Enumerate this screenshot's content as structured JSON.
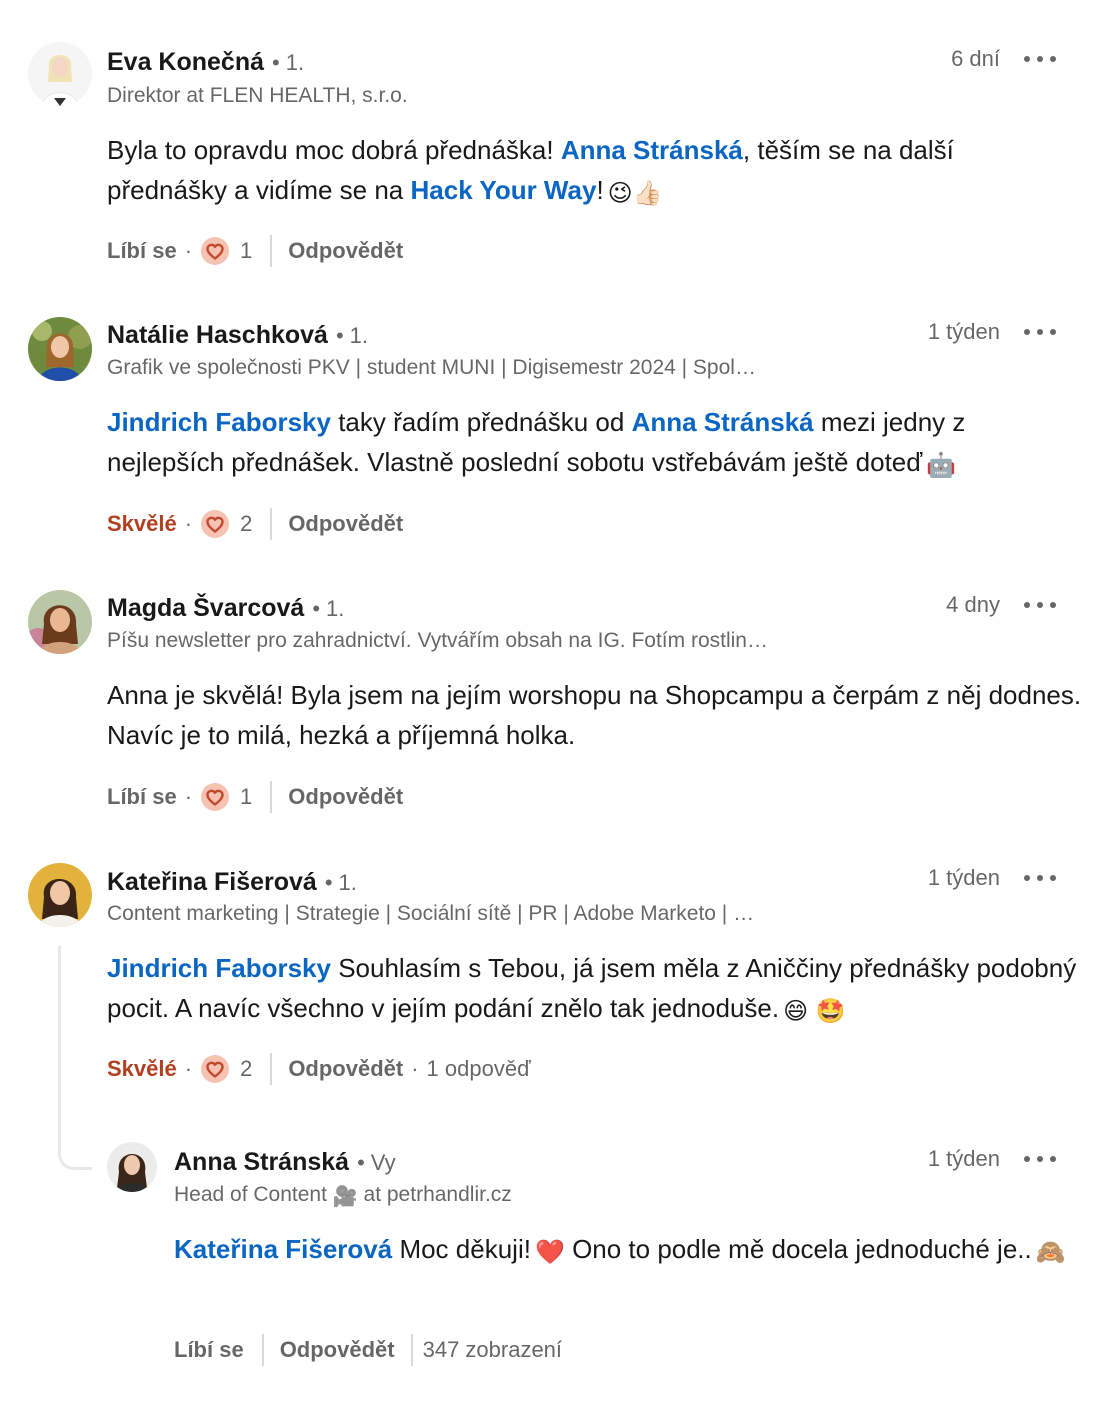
{
  "comments": [
    {
      "author": "Eva Konečná",
      "degree": "1.",
      "headline": "Direktor at FLEN HEALTH, s.r.o.",
      "time": "6 dní",
      "text": {
        "p1": "Byla to opravdu moc dobrá přednáška! ",
        "mention1": "Anna Stránská",
        "p2": ", těším se na další přednášky a vidíme se na ",
        "mention2": "Hack Your Way",
        "p3": "!",
        "emoji": "😉👍🏻"
      },
      "like_label": "Líbí se",
      "reaction_count": "1",
      "reply_label": "Odpovědět"
    },
    {
      "author": "Natálie Haschková",
      "degree": "1.",
      "headline": "Grafik ve společnosti PKV | student MUNI | Digisemestr 2024 | Spol…",
      "time": "1 týden",
      "text": {
        "mention1": "Jindrich Faborsky",
        "p1": " taky řadím přednášku od ",
        "mention2": "Anna Stránská",
        "p2": " mezi jedny z nejlepších přednášek. Vlastně poslední sobotu vstřebávám ještě doteď",
        "emoji": "🤖"
      },
      "like_label": "Skvělé",
      "reaction_count": "2",
      "reply_label": "Odpovědět"
    },
    {
      "author": "Magda Švarcová",
      "degree": "1.",
      "headline": "Píšu newsletter pro zahradnictví. Vytvářím obsah na IG. Fotím rostlin…",
      "time": "4 dny",
      "text": {
        "p1": "Anna je skvělá! Byla jsem na jejím worshopu na Shopcampu a čerpám z něj dodnes. Navíc je to milá, hezká a příjemná holka."
      },
      "like_label": "Líbí se",
      "reaction_count": "1",
      "reply_label": "Odpovědět"
    },
    {
      "author": "Kateřina Fišerová",
      "degree": "1.",
      "headline": "Content marketing | Strategie | Sociální sítě | PR | Adobe Marketo | …",
      "time": "1 týden",
      "text": {
        "mention1": "Jindrich Faborsky",
        "p1": " Souhlasím s Tebou, já jsem měla z Aniččiny přednášky podobný pocit. A navíc všechno v jejím podání znělo tak jednoduše.",
        "emoji": "😄 🤩"
      },
      "like_label": "Skvělé",
      "reaction_count": "2",
      "reply_label": "Odpovědět",
      "replies_count": "1 odpověď"
    }
  ],
  "reply": {
    "author": "Anna Stránská",
    "degree": "Vy",
    "headline_pre": "Head of Content",
    "headline_emoji": "🎥",
    "headline_post": "at petrhandlir.cz",
    "time": "1 týden",
    "text": {
      "mention1": "Kateřina Fišerová",
      "p1": " Moc děkuji!",
      "emoji1": "❤️",
      "p2": " Ono to podle mě docela jednoduché je..",
      "emoji2": "🙈"
    },
    "like_label": "Líbí se",
    "reply_label": "Odpovědět",
    "views": "347 zobrazení"
  },
  "colors": {
    "mention": "#0a66c2",
    "active_reaction": "#b24020",
    "heart_fill": "#f6c3b3",
    "heart_stroke": "#c24a2c"
  }
}
